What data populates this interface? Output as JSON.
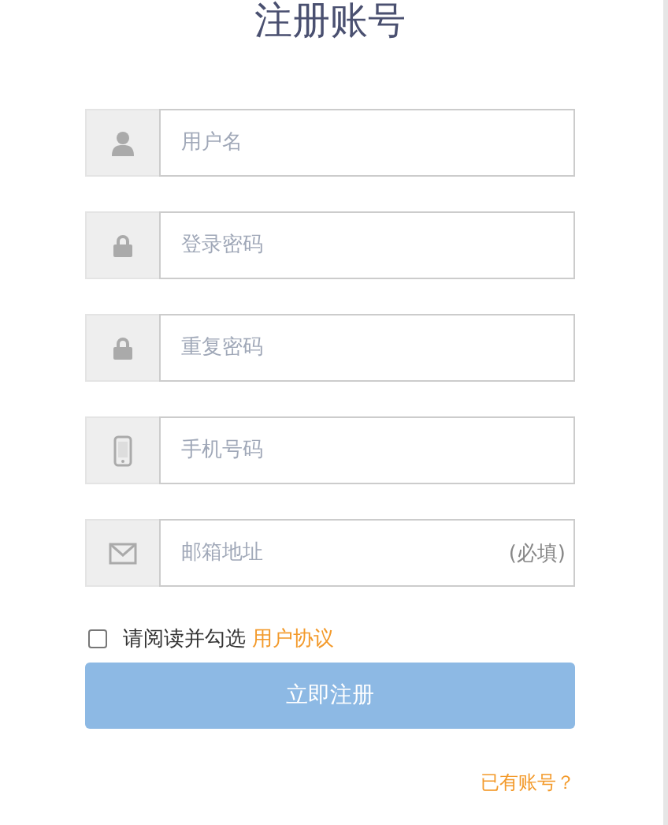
{
  "title": "注册账号",
  "fields": [
    {
      "kind": "username",
      "placeholder": "用户名"
    },
    {
      "kind": "password",
      "placeholder": "登录密码"
    },
    {
      "kind": "password",
      "placeholder": "重复密码"
    },
    {
      "kind": "phone",
      "placeholder": "手机号码"
    },
    {
      "kind": "email",
      "placeholder": "邮箱地址",
      "suffix": "(必填)"
    }
  ],
  "agreement": {
    "checked": false,
    "text": "请阅读并勾选",
    "link": "用户协议"
  },
  "submit": {
    "label": "立即注册",
    "disabled": true
  },
  "login_link": "已有账号？"
}
